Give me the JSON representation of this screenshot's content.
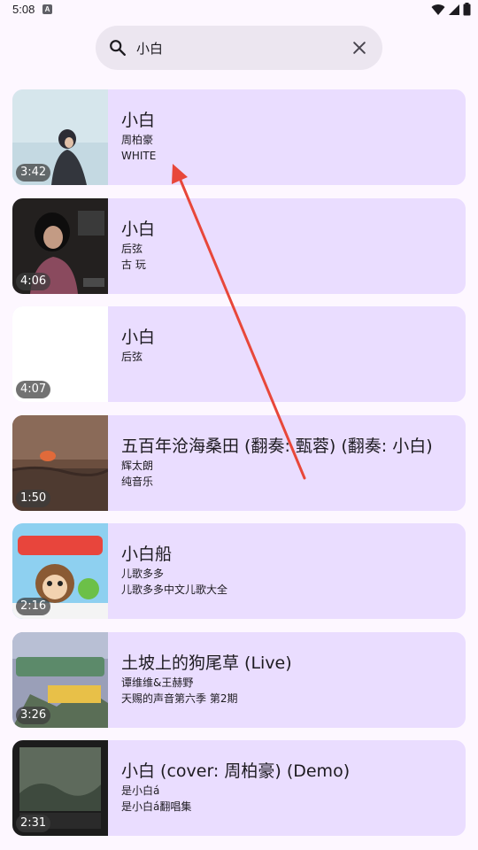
{
  "status_bar": {
    "time": "5:08",
    "notification_glyph": "A",
    "icons": [
      "wifi-icon",
      "signal-icon",
      "battery-icon"
    ]
  },
  "search": {
    "query": "小白",
    "placeholder": ""
  },
  "colors": {
    "background": "#fdf7ff",
    "search_bar": "#ece6f0",
    "card": "#eaddff",
    "arrow": "#e8473a"
  },
  "results": [
    {
      "title": "小白",
      "line1": "周柏豪",
      "line2": "WHITE",
      "duration": "3:42"
    },
    {
      "title": "小白",
      "line1": "后弦",
      "line2": "古 玩",
      "duration": "4:06"
    },
    {
      "title": "小白",
      "line1": "后弦",
      "line2": "",
      "duration": "4:07"
    },
    {
      "title": "五百年沧海桑田 (翻奏: 甄蓉) (翻奏: 小白)",
      "line1": "辉太朗",
      "line2": "纯音乐",
      "duration": "1:50"
    },
    {
      "title": "小白船",
      "line1": "儿歌多多",
      "line2": "儿歌多多中文儿歌大全",
      "duration": "2:16"
    },
    {
      "title": "土坡上的狗尾草 (Live)",
      "line1": "谭维维&王赫野",
      "line2": "天赐的声音第六季 第2期",
      "duration": "3:26"
    },
    {
      "title": "小白 (cover: 周柏豪) (Demo)",
      "line1": "是小白á",
      "line2": "是小白á翻唱集",
      "duration": "2:31"
    }
  ]
}
